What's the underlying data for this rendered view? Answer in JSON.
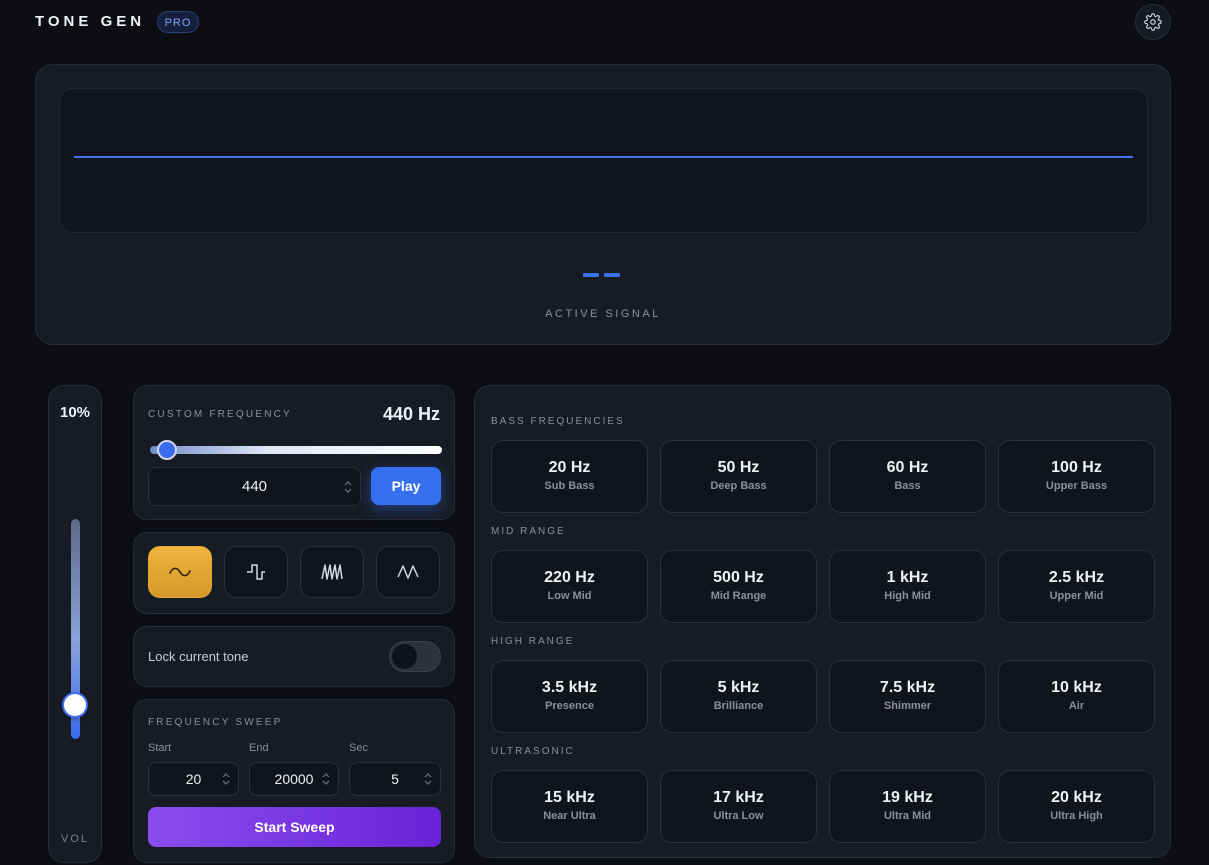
{
  "header": {
    "brand": "TONE GEN",
    "badge": "PRO",
    "settings_icon": "gear-icon"
  },
  "visualizer": {
    "status_symbol": "--",
    "label": "ACTIVE SIGNAL"
  },
  "volume": {
    "percent": "10%",
    "level": 0.1,
    "label": "VOL"
  },
  "custom_frequency": {
    "caption": "CUSTOM FREQUENCY",
    "readout": "440 Hz",
    "input_value": "440",
    "play_label": "Play"
  },
  "waveforms": [
    {
      "name": "sine",
      "icon": "sine-wave-icon",
      "active": true
    },
    {
      "name": "square",
      "icon": "square-wave-icon",
      "active": false
    },
    {
      "name": "sawtooth",
      "icon": "sawtooth-wave-icon",
      "active": false
    },
    {
      "name": "triangle",
      "icon": "triangle-wave-icon",
      "active": false
    }
  ],
  "lock": {
    "label": "Lock current tone",
    "on": false
  },
  "sweep": {
    "caption": "FREQUENCY SWEEP",
    "start_label": "Start",
    "end_label": "End",
    "sec_label": "Sec",
    "start_value": "20",
    "end_value": "20000",
    "sec_value": "5",
    "button_label": "Start Sweep"
  },
  "presets": [
    {
      "section": "BASS FREQUENCIES",
      "items": [
        {
          "freq": "20 Hz",
          "name": "Sub Bass"
        },
        {
          "freq": "50 Hz",
          "name": "Deep Bass"
        },
        {
          "freq": "60 Hz",
          "name": "Bass"
        },
        {
          "freq": "100 Hz",
          "name": "Upper Bass"
        }
      ]
    },
    {
      "section": "MID RANGE",
      "items": [
        {
          "freq": "220 Hz",
          "name": "Low Mid"
        },
        {
          "freq": "500 Hz",
          "name": "Mid Range"
        },
        {
          "freq": "1 kHz",
          "name": "High Mid"
        },
        {
          "freq": "2.5 kHz",
          "name": "Upper Mid"
        }
      ]
    },
    {
      "section": "HIGH RANGE",
      "items": [
        {
          "freq": "3.5 kHz",
          "name": "Presence"
        },
        {
          "freq": "5 kHz",
          "name": "Brilliance"
        },
        {
          "freq": "7.5 kHz",
          "name": "Shimmer"
        },
        {
          "freq": "10 kHz",
          "name": "Air"
        }
      ]
    },
    {
      "section": "ULTRASONIC",
      "items": [
        {
          "freq": "15 kHz",
          "name": "Near Ultra"
        },
        {
          "freq": "17 kHz",
          "name": "Ultra Low"
        },
        {
          "freq": "19 kHz",
          "name": "Ultra Mid"
        },
        {
          "freq": "20 kHz",
          "name": "Ultra High"
        }
      ]
    }
  ],
  "colors": {
    "accent_blue": "#3470ee",
    "accent_gold": "#e5a634",
    "accent_purple": "#7a34e2",
    "background": "#0c0e13",
    "card": "#171b24"
  }
}
